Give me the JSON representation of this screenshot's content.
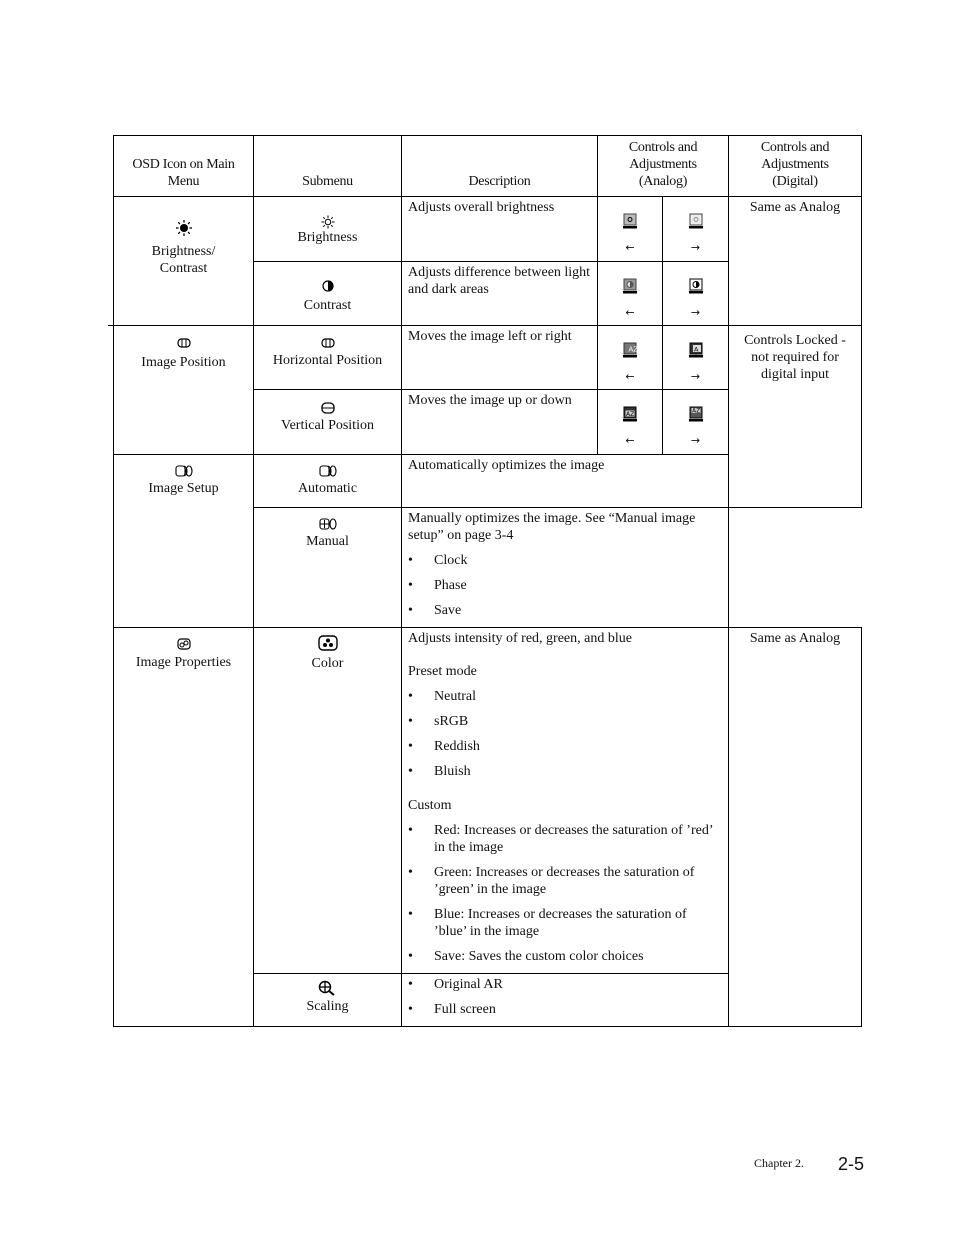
{
  "table": {
    "headers": {
      "osd_icon": "OSD Icon on Main Menu",
      "submenu": "Submenu",
      "description": "Description",
      "analog": "Controls and Adjustments (Analog)",
      "digital": "Controls and Adjustments (Digital)"
    },
    "groups": [
      {
        "main_label": "Brightness/ Contrast",
        "main_icon": "sun-icon",
        "digital": "Same as Analog",
        "rows": [
          {
            "submenu": "Brightness",
            "icon": "sun-outline-icon",
            "description": "Adjusts overall brightness",
            "left_arrow": "←",
            "right_arrow": "→"
          },
          {
            "submenu": "Contrast",
            "icon": "contrast-icon",
            "description": "Adjusts difference between light and dark areas",
            "left_arrow": "←",
            "right_arrow": "→"
          }
        ]
      },
      {
        "main_label": "Image Position",
        "main_icon": "position-icon",
        "digital": "Controls Locked - not required  for digital input",
        "rows": [
          {
            "submenu": "Horizontal Position",
            "icon": "horizontal-position-icon",
            "description": "Moves the image left or right",
            "left_arrow": "←",
            "right_arrow": "→"
          },
          {
            "submenu": "Vertical Position",
            "icon": "vertical-position-icon",
            "description": "Moves the image up or down",
            "left_arrow": "←",
            "right_arrow": "→"
          }
        ]
      },
      {
        "main_label": "Image Setup",
        "main_icon": "image-setup-icon",
        "rows": [
          {
            "submenu": "Automatic",
            "icon": "automatic-icon",
            "description": "Automatically optimizes the image"
          },
          {
            "submenu": "Manual",
            "icon": "manual-icon",
            "description": "Manually optimizes the image. See “Manual image setup” on page 3-4",
            "bullets": [
              "Clock",
              "Phase",
              "Save"
            ]
          }
        ]
      },
      {
        "main_label": "Image Properties",
        "main_icon": "image-properties-icon",
        "digital": "Same as Analog",
        "rows": [
          {
            "submenu": "Color",
            "icon": "color-icon",
            "description": "Adjusts intensity of red, green, and blue",
            "preset_label": "Preset mode",
            "preset_bullets": [
              "Neutral",
              "sRGB",
              "Reddish",
              "Bluish"
            ],
            "custom_label": "Custom",
            "custom_bullets": [
              "Red: Increases or decreases the saturation of ’red’ in the image",
              "Green: Increases or decreases the saturation of ’green’ in the image",
              "Blue: Increases or decreases the saturation of ’blue’ in the image",
              "Save: Saves the custom color choices"
            ]
          },
          {
            "submenu": "Scaling",
            "icon": "scaling-icon",
            "bullets": [
              "Original AR",
              "Full screen"
            ]
          }
        ]
      }
    ]
  },
  "footer": {
    "chapter": "Chapter 2.",
    "page": "2-5"
  }
}
